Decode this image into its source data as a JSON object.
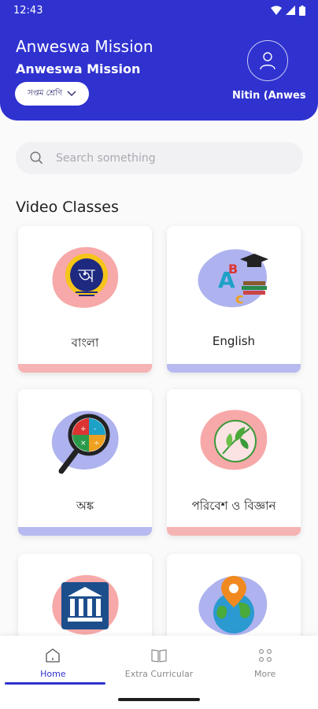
{
  "status_bar": {
    "time": "12:43"
  },
  "header": {
    "app_title": "Anweswa Mission",
    "org_name": "Anweswa Mission",
    "class_select": "সপ্তম শ্রেণি",
    "user_name": "Nitin (Anwes"
  },
  "search": {
    "placeholder": "Search something"
  },
  "section_title": "Video Classes",
  "subjects": [
    {
      "label": "বাংলা",
      "icon": "bengali-letter-icon",
      "blob_color": "#f7a8a8",
      "bar_color": "#f6b3b3"
    },
    {
      "label": "English",
      "icon": "abc-graduation-icon",
      "blob_color": "#aeb2ee",
      "bar_color": "#b7baf0"
    },
    {
      "label": "অঙ্ক",
      "icon": "math-magnifier-icon",
      "blob_color": "#aeb2ee",
      "bar_color": "#b7baf0"
    },
    {
      "label": "পরিবেশ ও বিজ্ঞান",
      "icon": "leaf-icon",
      "blob_color": "#f7a8a8",
      "bar_color": "#f6b3b3"
    },
    {
      "label": "",
      "icon": "museum-icon",
      "blob_color": "#f7a8a8",
      "bar_color": "#f6b3b3"
    },
    {
      "label": "",
      "icon": "globe-pin-icon",
      "blob_color": "#aeb2ee",
      "bar_color": "#b7baf0"
    }
  ],
  "bottom_nav": [
    {
      "label": "Home",
      "icon": "home-icon",
      "active": true
    },
    {
      "label": "Extra Curricular",
      "icon": "book-icon",
      "active": false
    },
    {
      "label": "More",
      "icon": "grid-dots-icon",
      "active": false
    }
  ],
  "colors": {
    "primary": "#2f32cf",
    "pink": "#f7a8a8",
    "lavender": "#aeb2ee"
  }
}
